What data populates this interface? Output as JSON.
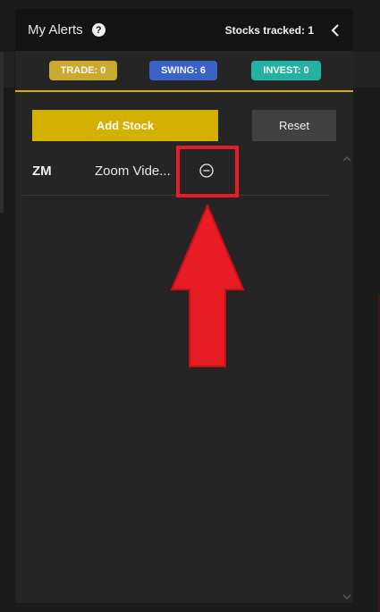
{
  "header": {
    "title": "My Alerts",
    "help_icon": "question-circle-icon",
    "tracked_label": "Stocks tracked: 1",
    "collapse_icon": "chevron-left-icon"
  },
  "filters": [
    {
      "label": "TRADE: 0",
      "color": "#c9a92e"
    },
    {
      "label": "SWING: 6",
      "color": "#3b63c6"
    },
    {
      "label": "INVEST: 0",
      "color": "#24b0a3"
    }
  ],
  "actions": {
    "add_label": "Add Stock",
    "reset_label": "Reset"
  },
  "stocks": [
    {
      "ticker": "ZM",
      "name": "Zoom Vide...",
      "remove_icon": "minus-circle-icon"
    }
  ],
  "annotation": {
    "highlight_color": "#e81c24",
    "arrow_icon": "red-up-arrow"
  },
  "colors": {
    "accent": "#d4b000",
    "panel": "#252525",
    "header": "#141414"
  }
}
